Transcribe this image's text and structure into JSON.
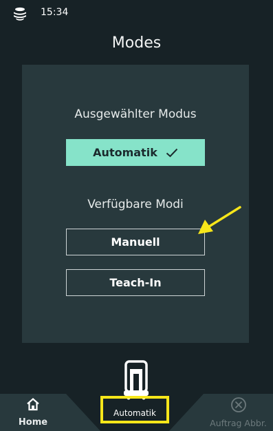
{
  "status_bar": {
    "logo_icon": "stacked-discs-logo",
    "time": "15:34"
  },
  "page": {
    "title": "Modes"
  },
  "modes": {
    "selected_section_label": "Ausgewählter Modus",
    "selected_mode": "Automatik",
    "selected_icon": "check-icon",
    "available_section_label": "Verfügbare Modi",
    "available_modes": [
      "Manuell",
      "Teach-In"
    ]
  },
  "bottom_nav": {
    "home_label": "Home",
    "home_icon": "home-icon",
    "center_icon": "robot-icon",
    "mode_label": "Automatik",
    "abort_label": "Auftrag Abbr.",
    "abort_icon": "cancel-circle-icon"
  },
  "colors": {
    "background": "#172226",
    "panel": "#28393d",
    "selected_mode": "#86e3c9",
    "highlight": "#f7e61a",
    "disabled_text": "#6c797c"
  }
}
